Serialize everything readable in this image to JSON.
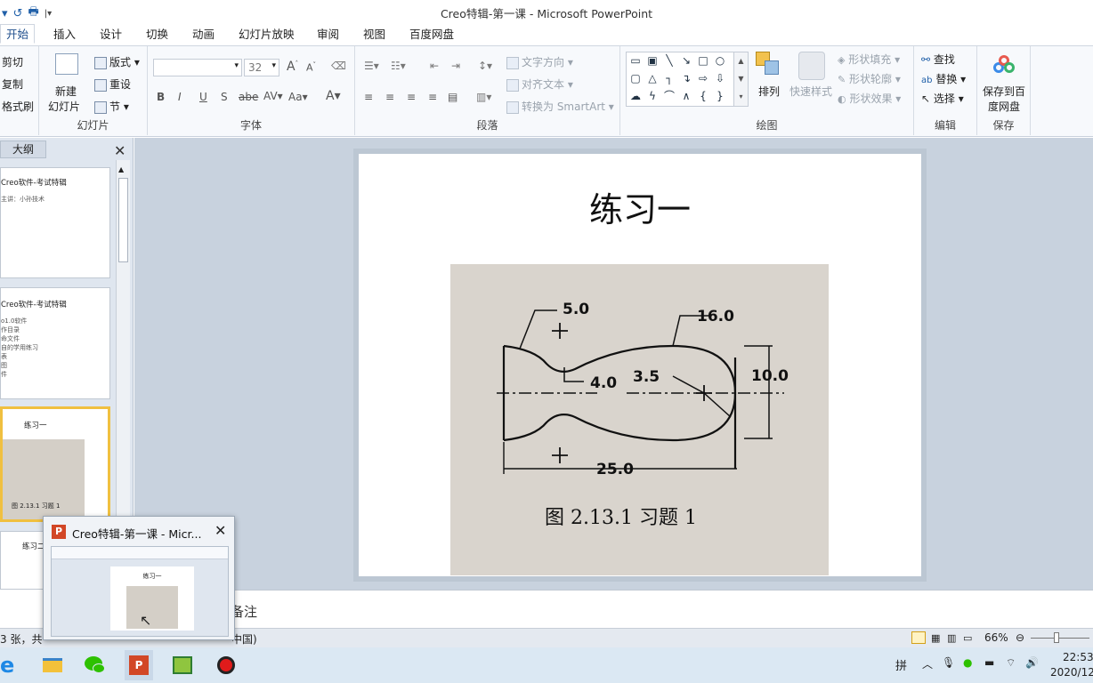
{
  "window": {
    "title": "Creo特辑-第一课  -  Microsoft PowerPoint"
  },
  "tabs": [
    "开始",
    "插入",
    "设计",
    "切换",
    "动画",
    "幻灯片放映",
    "审阅",
    "视图",
    "百度网盘"
  ],
  "ribbon": {
    "clipboard": {
      "cut": "剪切",
      "copy": "复制",
      "format": "格式刷"
    },
    "slides": {
      "new_slide_1": "新建",
      "new_slide_2": "幻灯片",
      "layout": "版式",
      "reset": "重设",
      "section": "节",
      "label": "幻灯片"
    },
    "font": {
      "size": "32",
      "label": "字体"
    },
    "paragraph": {
      "text_direction": "文字方向",
      "align_text": "对齐文本",
      "smartart": "转换为 SmartArt",
      "label": "段落"
    },
    "drawing": {
      "arrange": "排列",
      "quick_styles": "快速样式",
      "fill": "形状填充",
      "outline": "形状轮廓",
      "effects": "形状效果",
      "label": "绘图"
    },
    "editing": {
      "find": "查找",
      "replace": "替换",
      "select": "选择",
      "label": "编辑"
    },
    "save": {
      "save_1": "保存到百",
      "save_2": "度网盘",
      "label": "保存"
    }
  },
  "left_pane": {
    "outline_tab": "大纲",
    "thumbs": [
      {
        "title": "Creo软件-考试特辑",
        "lines": [
          "主讲：小孙技术"
        ]
      },
      {
        "title": "Creo软件-考试特辑",
        "lines": [
          "o1.0软件",
          "作目录",
          "命文件",
          "自的学用练习",
          "表",
          "图",
          "件"
        ]
      },
      {
        "title": "练习一",
        "caption": "图 2.13.1   习题 1"
      },
      {
        "title": "练习二"
      }
    ]
  },
  "slide": {
    "title": "练习一",
    "figure": {
      "dims": [
        "5.0",
        "16.0",
        "4.0",
        "3.5",
        "10.0",
        "25.0"
      ],
      "caption": "图 2.13.1    习题 1"
    }
  },
  "notes": {
    "placeholder": "备注"
  },
  "status": {
    "left": "3 张，共",
    "lang": "中国)",
    "zoom": "66%"
  },
  "taskbar": {
    "popup_title": "Creo特辑-第一课 - Micr...",
    "preview_title": "练习一",
    "ime": "拼",
    "time": "22:53",
    "date": "2020/12/"
  }
}
